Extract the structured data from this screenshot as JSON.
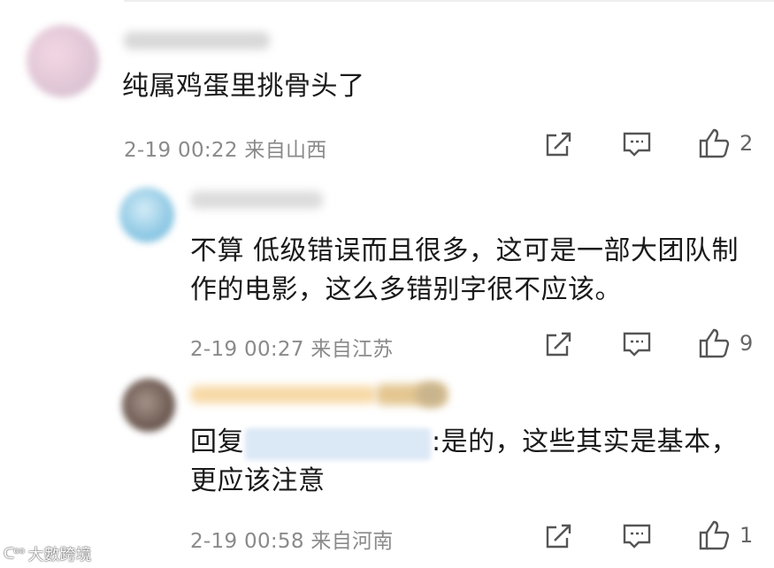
{
  "comments": [
    {
      "text": "纯属鸡蛋里挑骨头了",
      "meta": "2-19 00:22 来自山西",
      "likes": "2"
    },
    {
      "text": "不算 低级错误而且很多，这可是一部大团队制作的电影，这么多错别字很不应该。",
      "meta": "2-19 00:27 来自江苏",
      "likes": "9"
    },
    {
      "reply_prefix": "回复",
      "text": ":是的，这些其实是基本，更应该注意",
      "meta": "2-19 00:58 来自河南",
      "likes": "1"
    }
  ],
  "icons": {
    "share": "share-icon",
    "comment": "comment-icon",
    "like": "thumbs-up-icon"
  },
  "colors": {
    "text": "#1a1a1a",
    "meta": "#8a8a8a",
    "icon": "#555555"
  },
  "watermark": {
    "logo": "ᑕᵒᵒ",
    "text": "大數跨境"
  }
}
